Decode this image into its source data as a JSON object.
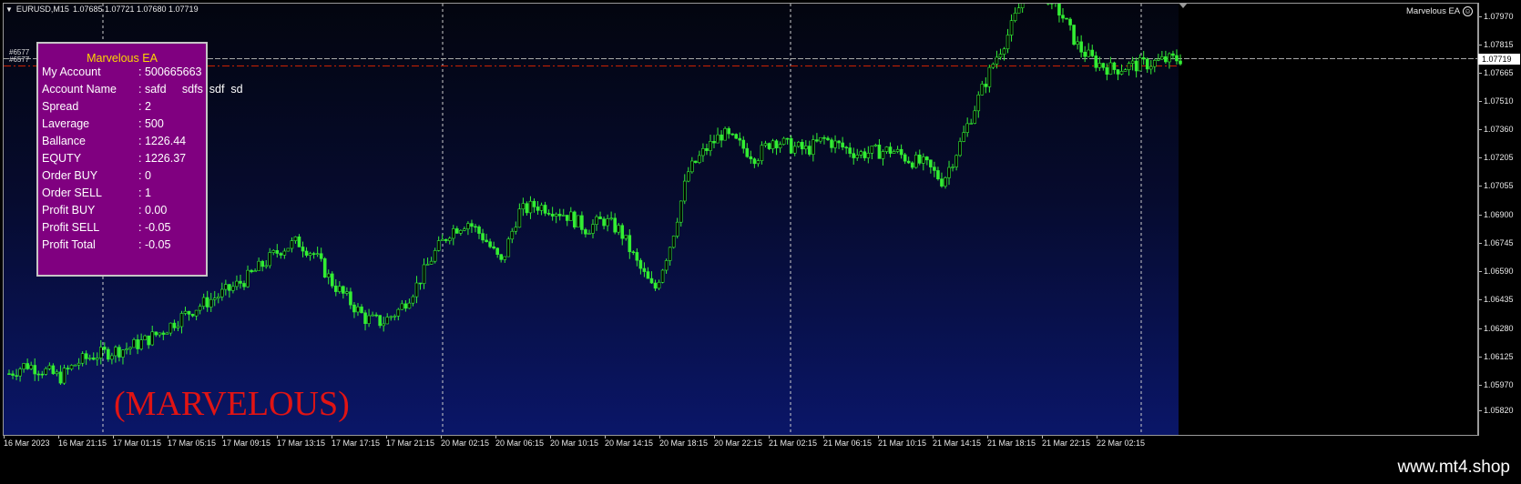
{
  "chart": {
    "symbol": "EURUSD,M15",
    "ohlc": "1.07685 1.07721 1.07680 1.07719",
    "ea_name": "Marvelous EA",
    "watermark": "(MARVELOUS)",
    "current_price": "1.07719",
    "hidden_label_1": "#6577",
    "hidden_label_2": "#6577",
    "site": "www.mt4.shop"
  },
  "panel": {
    "title": "Marvelous EA",
    "rows": [
      {
        "label": "My Account",
        "value": ": 500665663"
      },
      {
        "label": "Account Name",
        "value": ": safd     sdfs  sdf  sd"
      },
      {
        "label": "Spread",
        "value": ": 2"
      },
      {
        "label": "Laverage",
        "value": ": 500"
      },
      {
        "label": "Ballance",
        "value": ": 1226.44"
      },
      {
        "label": "EQUTY",
        "value": ": 1226.37"
      },
      {
        "label": "Order BUY",
        "value": ": 0"
      },
      {
        "label": "Order SELL",
        "value": ": 1"
      },
      {
        "label": "Profit BUY",
        "value": ": 0.00"
      },
      {
        "label": "Profit SELL",
        "value": ": -0.05"
      },
      {
        "label": "Profit Total",
        "value": ": -0.05"
      }
    ]
  },
  "price_axis": [
    "1.07970",
    "1.07815",
    "1.07665",
    "1.07510",
    "1.07360",
    "1.07205",
    "1.07055",
    "1.06900",
    "1.06745",
    "1.06590",
    "1.06435",
    "1.06280",
    "1.06125",
    "1.05970",
    "1.05820"
  ],
  "time_axis": [
    "16 Mar 2023",
    "16 Mar 21:15",
    "17 Mar 01:15",
    "17 Mar 05:15",
    "17 Mar 09:15",
    "17 Mar 13:15",
    "17 Mar 17:15",
    "17 Mar 21:15",
    "20 Mar 02:15",
    "20 Mar 06:15",
    "20 Mar 10:15",
    "20 Mar 14:15",
    "20 Mar 18:15",
    "20 Mar 22:15",
    "21 Mar 02:15",
    "21 Mar 06:15",
    "21 Mar 10:15",
    "21 Mar 14:15",
    "21 Mar 18:15",
    "21 Mar 22:15",
    "22 Mar 02:15"
  ],
  "colors": {
    "candle": "#33ee33",
    "panel_bg": "#800080",
    "panel_title": "#ffd700",
    "watermark": "#e01414",
    "order_line": "#cc2200",
    "bid_line": "#a8a8a8"
  },
  "series": {
    "close": [
      1.06,
      1.0605,
      1.0602,
      1.0598,
      1.0606,
      1.061,
      1.0612,
      1.0614,
      1.0618,
      1.0623,
      1.063,
      1.0636,
      1.0641,
      1.0646,
      1.0652,
      1.066,
      1.0668,
      1.0672,
      1.0665,
      1.065,
      1.064,
      1.063,
      1.0628,
      1.0635,
      1.0648,
      1.0665,
      1.0678,
      1.0683,
      1.0674,
      1.066,
      1.0688,
      1.0692,
      1.069,
      1.0686,
      1.0679,
      1.0684,
      1.0678,
      1.066,
      1.0645,
      1.0672,
      1.071,
      1.0722,
      1.0731,
      1.0725,
      1.0718,
      1.0728,
      1.0724,
      1.0722,
      1.0728,
      1.0724,
      1.072,
      1.0721,
      1.0722,
      1.0717,
      1.0714,
      1.0705,
      1.0725,
      1.0748,
      1.077,
      1.0788,
      1.0812,
      1.0808,
      1.0796,
      1.0778,
      1.077,
      1.0766,
      1.0768,
      1.0769,
      1.0771,
      1.0772
    ]
  }
}
